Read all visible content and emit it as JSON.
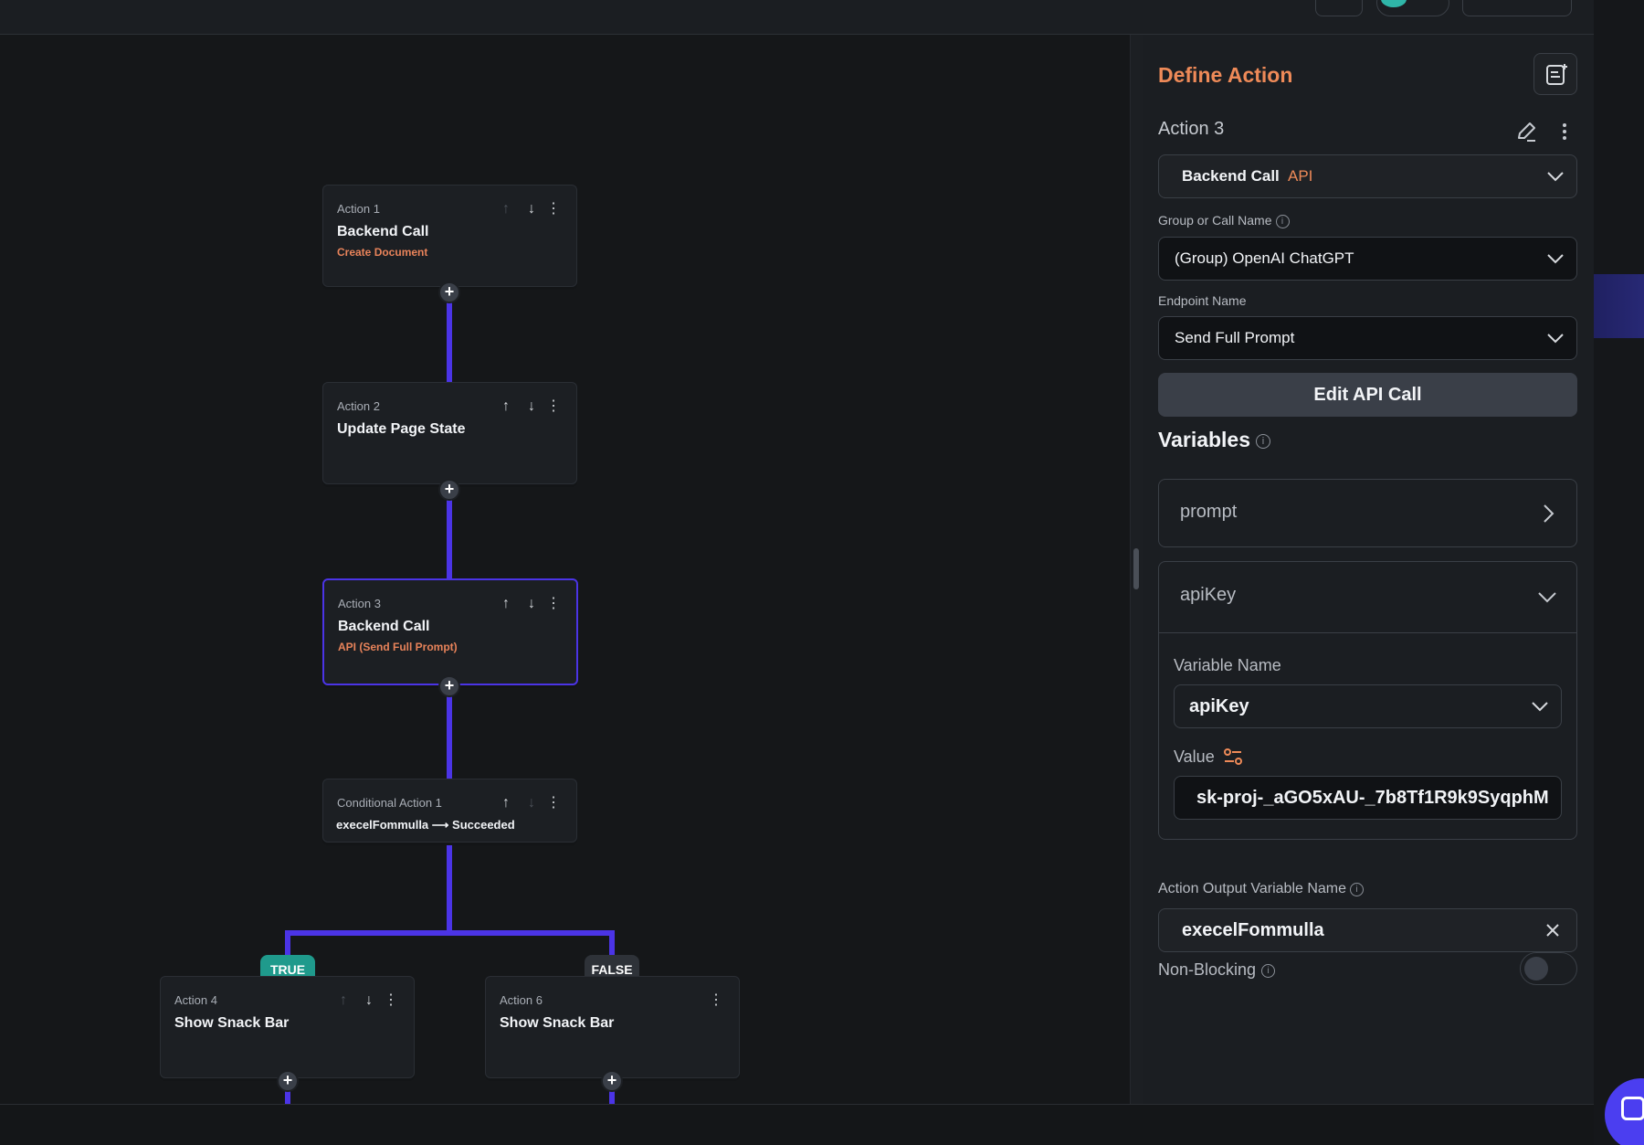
{
  "canvas": {
    "actions": [
      {
        "number": "Action 1",
        "title": "Backend Call",
        "subtitle": "Create Document"
      },
      {
        "number": "Action 2",
        "title": "Update Page State",
        "subtitle": ""
      },
      {
        "number": "Action 3",
        "title": "Backend Call",
        "subtitle": "API (Send Full Prompt)"
      },
      {
        "number": "Action 4",
        "title": "Show Snack Bar",
        "subtitle": ""
      },
      {
        "number": "Action 6",
        "title": "Show Snack Bar",
        "subtitle": ""
      }
    ],
    "conditional": {
      "number": "Conditional Action 1",
      "text": "execelFommulla ⟶ Succeeded"
    },
    "branches": {
      "true_label": "TRUE",
      "false_label": "FALSE"
    },
    "controls": {
      "up": "↑",
      "down": "↓",
      "more": "⋮",
      "add": "+"
    }
  },
  "panel": {
    "title": "Define Action",
    "action_name": "Action 3",
    "action_type": {
      "label": "Backend Call",
      "tag": "API"
    },
    "group_label": "Group or Call Name",
    "group_value": "(Group) OpenAI ChatGPT",
    "endpoint_label": "Endpoint Name",
    "endpoint_value": "Send Full Prompt",
    "edit_button": "Edit API Call",
    "variables_title": "Variables",
    "variables": [
      {
        "name": "prompt"
      },
      {
        "name": "apiKey"
      }
    ],
    "variable_name_label": "Variable Name",
    "variable_name_value": "apiKey",
    "value_label": "Value",
    "value_text": "sk-proj-_aGO5xAU-_7b8Tf1R9k9SyqphM",
    "output_label": "Action Output Variable Name",
    "output_value": "execelFommulla",
    "non_blocking_label": "Non-Blocking",
    "non_blocking_on": false,
    "info_glyph": "i"
  },
  "colors": {
    "accent": "#4b34e6",
    "orange": "#ee8a58",
    "true_green": "#1f9a8c",
    "panel_bg": "#1b1e22"
  }
}
